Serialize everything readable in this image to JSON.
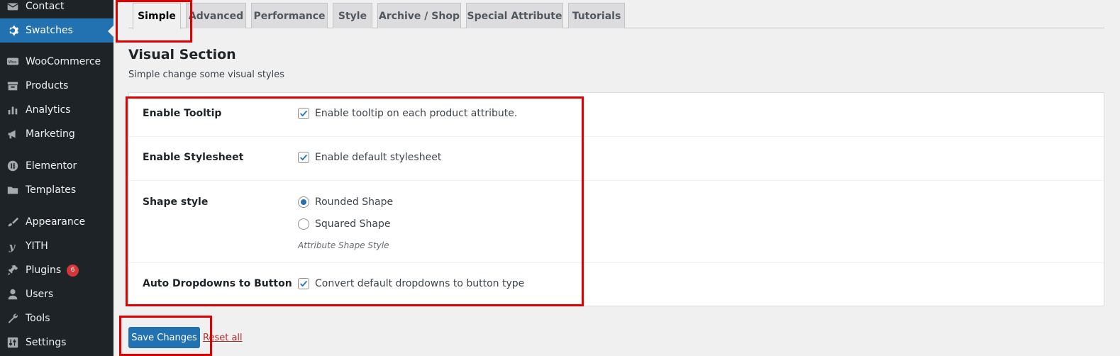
{
  "sidebar": {
    "items": [
      {
        "label": "Contact",
        "icon": "envelope-icon"
      },
      {
        "label": "Swatches",
        "icon": "gear-icon",
        "current": true
      },
      {
        "label": "WooCommerce",
        "icon": "woocommerce-icon"
      },
      {
        "label": "Products",
        "icon": "archive-icon"
      },
      {
        "label": "Analytics",
        "icon": "bar-chart-icon"
      },
      {
        "label": "Marketing",
        "icon": "megaphone-icon"
      },
      {
        "label": "Elementor",
        "icon": "elementor-icon"
      },
      {
        "label": "Templates",
        "icon": "folder-icon"
      },
      {
        "label": "Appearance",
        "icon": "paintbrush-icon"
      },
      {
        "label": "YITH",
        "icon": "yith-icon"
      },
      {
        "label": "Plugins",
        "icon": "plugin-icon",
        "badge": "6"
      },
      {
        "label": "Users",
        "icon": "user-icon"
      },
      {
        "label": "Tools",
        "icon": "wrench-icon"
      },
      {
        "label": "Settings",
        "icon": "settings-sliders-icon"
      }
    ]
  },
  "tabs": [
    {
      "label": "Simple",
      "active": true
    },
    {
      "label": "Advanced"
    },
    {
      "label": "Performance"
    },
    {
      "label": "Style"
    },
    {
      "label": "Archive / Shop"
    },
    {
      "label": "Special Attribute"
    },
    {
      "label": "Tutorials"
    }
  ],
  "section": {
    "title": "Visual Section",
    "description": "Simple change some visual styles"
  },
  "settings": {
    "tooltip": {
      "label": "Enable Tooltip",
      "option": "Enable tooltip on each product attribute.",
      "checked": true
    },
    "stylesheet": {
      "label": "Enable Stylesheet",
      "option": "Enable default stylesheet",
      "checked": true
    },
    "shape": {
      "label": "Shape style",
      "options": [
        {
          "label": "Rounded Shape",
          "selected": true
        },
        {
          "label": "Squared Shape",
          "selected": false
        }
      ],
      "hint": "Attribute Shape Style"
    },
    "dropdowns": {
      "label": "Auto Dropdowns to Button",
      "option": "Convert default dropdowns to button type",
      "checked": true
    }
  },
  "footer": {
    "save_label": "Save Changes",
    "reset_label": "Reset all"
  },
  "colors": {
    "accent": "#2271b1",
    "sidebar_bg": "#1d2327",
    "annotation": "#e00000",
    "badge": "#d63638"
  }
}
